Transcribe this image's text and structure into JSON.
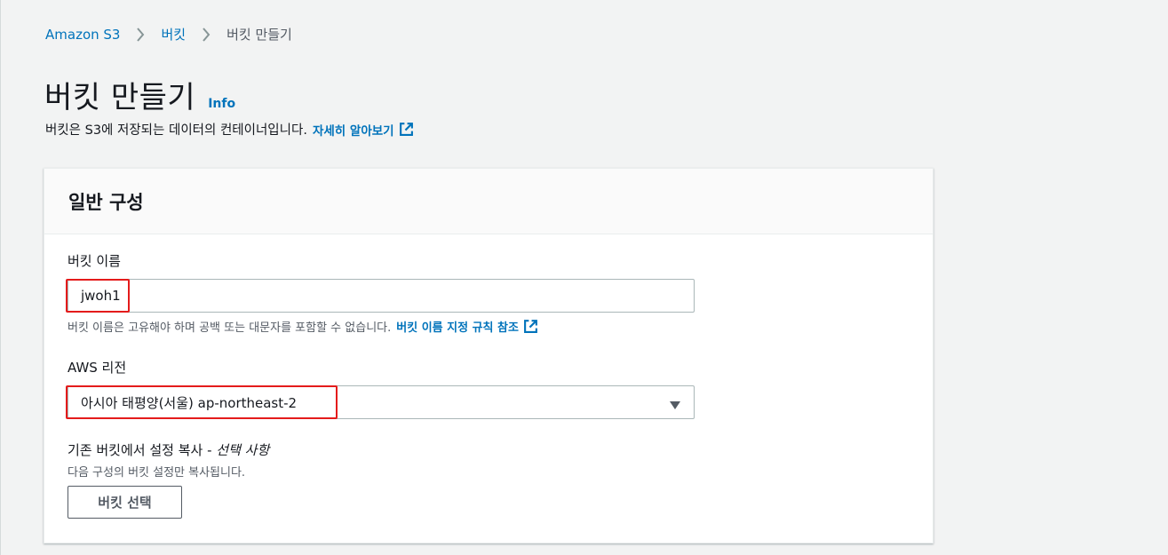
{
  "breadcrumb": {
    "items": [
      {
        "label": "Amazon S3"
      },
      {
        "label": "버킷"
      },
      {
        "label": "버킷 만들기"
      }
    ]
  },
  "header": {
    "title": "버킷 만들기",
    "info_label": "Info",
    "description": "버킷은 S3에 저장되는 데이터의 컨테이너입니다.",
    "learn_more": "자세히 알아보기"
  },
  "general": {
    "title": "일반 구성",
    "bucket_name": {
      "label": "버킷 이름",
      "value": "jwoh1",
      "hint": "버킷 이름은 고유해야 하며 공백 또는 대문자를 포함할 수 없습니다.",
      "rules_link": "버킷 이름 지정 규칙 참조"
    },
    "region": {
      "label": "AWS 리전",
      "value": "아시아 태평양(서울) ap-northeast-2"
    },
    "copy_settings": {
      "label": "기존 버킷에서 설정 복사 -",
      "optional": "선택 사항",
      "hint": "다음 구성의 버킷 설정만 복사됩니다.",
      "button": "버킷 선택"
    }
  },
  "colors": {
    "link": "#0073bb",
    "highlight": "#e41b1b",
    "background": "#f2f3f3"
  }
}
